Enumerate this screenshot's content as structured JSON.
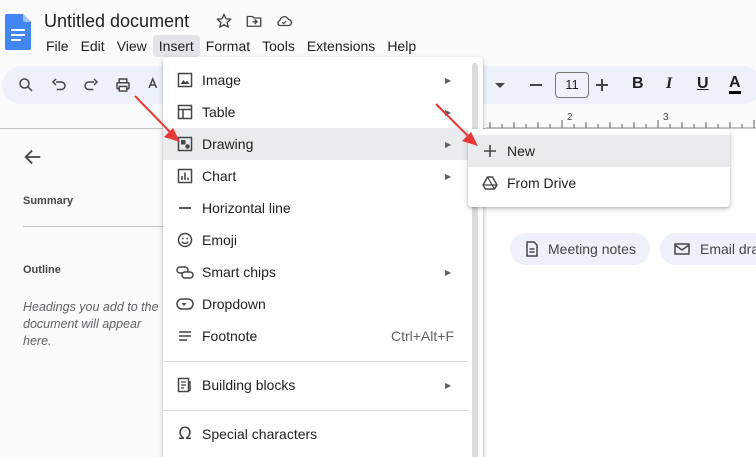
{
  "doc": {
    "title": "Untitled document"
  },
  "menubar": [
    "File",
    "Edit",
    "View",
    "Insert",
    "Format",
    "Tools",
    "Extensions",
    "Help"
  ],
  "toolbar": {
    "font_size": "11",
    "bold": "B",
    "italic": "I",
    "underline": "U",
    "text_color": "A"
  },
  "left_panel": {
    "summary": "Summary",
    "outline": "Outline",
    "outline_help": "Headings you add to the document will appear here."
  },
  "ruler": {
    "marks": [
      "2",
      "3"
    ]
  },
  "insert_menu": {
    "items": [
      {
        "label": "Image",
        "icon": "image-icon",
        "has_submenu": true
      },
      {
        "label": "Table",
        "icon": "table-icon",
        "has_submenu": true
      },
      {
        "label": "Drawing",
        "icon": "drawing-icon",
        "has_submenu": true
      },
      {
        "label": "Chart",
        "icon": "chart-icon",
        "has_submenu": true
      },
      {
        "label": "Horizontal line",
        "icon": "horizontal-line-icon",
        "has_submenu": false
      },
      {
        "label": "Emoji",
        "icon": "emoji-icon",
        "has_submenu": false
      },
      {
        "label": "Smart chips",
        "icon": "smart-chips-icon",
        "has_submenu": true
      },
      {
        "label": "Dropdown",
        "icon": "dropdown-icon",
        "has_submenu": false
      },
      {
        "label": "Footnote",
        "icon": "footnote-icon",
        "has_submenu": false,
        "shortcut": "Ctrl+Alt+F"
      },
      {
        "label": "Building blocks",
        "icon": "building-blocks-icon",
        "has_submenu": true
      },
      {
        "label": "Special characters",
        "icon": "omega-icon",
        "has_submenu": false
      }
    ]
  },
  "drawing_submenu": {
    "items": [
      {
        "label": "New",
        "icon": "plus-icon"
      },
      {
        "label": "From Drive",
        "icon": "drive-icon"
      }
    ]
  },
  "chips": [
    {
      "label": "Meeting notes",
      "icon": "doc-icon"
    },
    {
      "label": "Email dra",
      "icon": "email-icon"
    }
  ],
  "colors": {
    "docs_blue": "#4285f4",
    "annotation_red": "#e53935",
    "menu_hover": "#e9ebee"
  }
}
